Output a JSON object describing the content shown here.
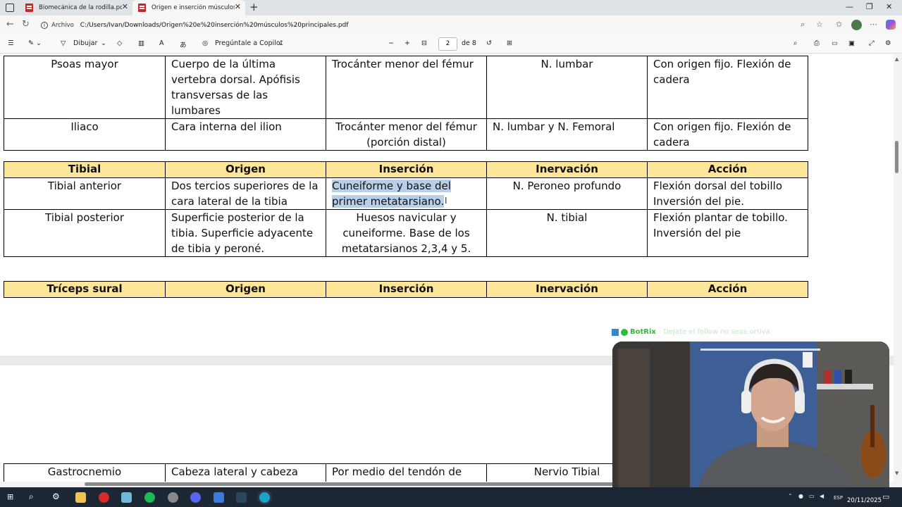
{
  "browser": {
    "tabs": [
      {
        "label": "Biomecánica de la rodilla.pdf",
        "active": false
      },
      {
        "label": "Origen e inserción músculos principales.pdf",
        "active": true
      }
    ],
    "address": {
      "scheme_label": "Archivo",
      "url": "C:/Users/Ivan/Downloads/Origen%20e%20inserción%20músculos%20principales.pdf"
    }
  },
  "pdf_toolbar": {
    "draw_label": "Dibujar",
    "copilot_label": "Pregúntale a Copilot",
    "page_current": "2",
    "page_total": "de 8"
  },
  "tables": {
    "iliopsoas": {
      "rows": [
        [
          "Psoas mayor",
          "Cuerpo de la última vertebra dorsal. Apófisis transversas de las lumbares",
          "Trocánter menor del fémur",
          "N. lumbar",
          "Con origen fijo. Flexión de cadera"
        ],
        [
          "Iliaco",
          "Cara interna del ilion",
          "Trocánter menor del fémur (porción distal)",
          "N. lumbar y N. Femoral",
          "Con origen fijo. Flexión de cadera"
        ]
      ]
    },
    "tibial": {
      "headers": [
        "Tibial",
        "Origen",
        "Inserción",
        "Inervación",
        "Acción"
      ],
      "rows": [
        [
          "Tibial anterior",
          "Dos tercios superiores de la cara lateral de la tibia",
          "Cuneiforme y base del primer metatarsiano.",
          "N. Peroneo profundo",
          "Flexión dorsal del tobillo Inversión del pie."
        ],
        [
          "Tibial posterior",
          "Superficie posterior de la tibia. Superficie adyacente de tibia y peroné.",
          "Huesos navicular y cuneiforme. Base de los metatarsianos 2,3,4 y 5.",
          "N. tibial",
          "Flexión plantar de tobillo. Inversión del pie"
        ]
      ]
    },
    "triceps": {
      "headers": [
        "Tríceps sural",
        "Origen",
        "Inserción",
        "Inervación",
        "Acción"
      ]
    },
    "gastrocnemio": {
      "rows": [
        [
          "Gastrocnemio",
          "Cabeza lateral y cabeza",
          "Por medio del tendón de",
          "Nervio Tibial",
          ""
        ]
      ]
    }
  },
  "stream": {
    "chat_user": "BotRix",
    "chat_message": ": Dejate el follow no seas ortiva"
  },
  "taskbar": {
    "language": "ESP",
    "date": "20/11/2025"
  },
  "colors": {
    "header_fill": "#fde69a",
    "selection": "#b7cfe8",
    "taskbar": "#1c2733"
  }
}
